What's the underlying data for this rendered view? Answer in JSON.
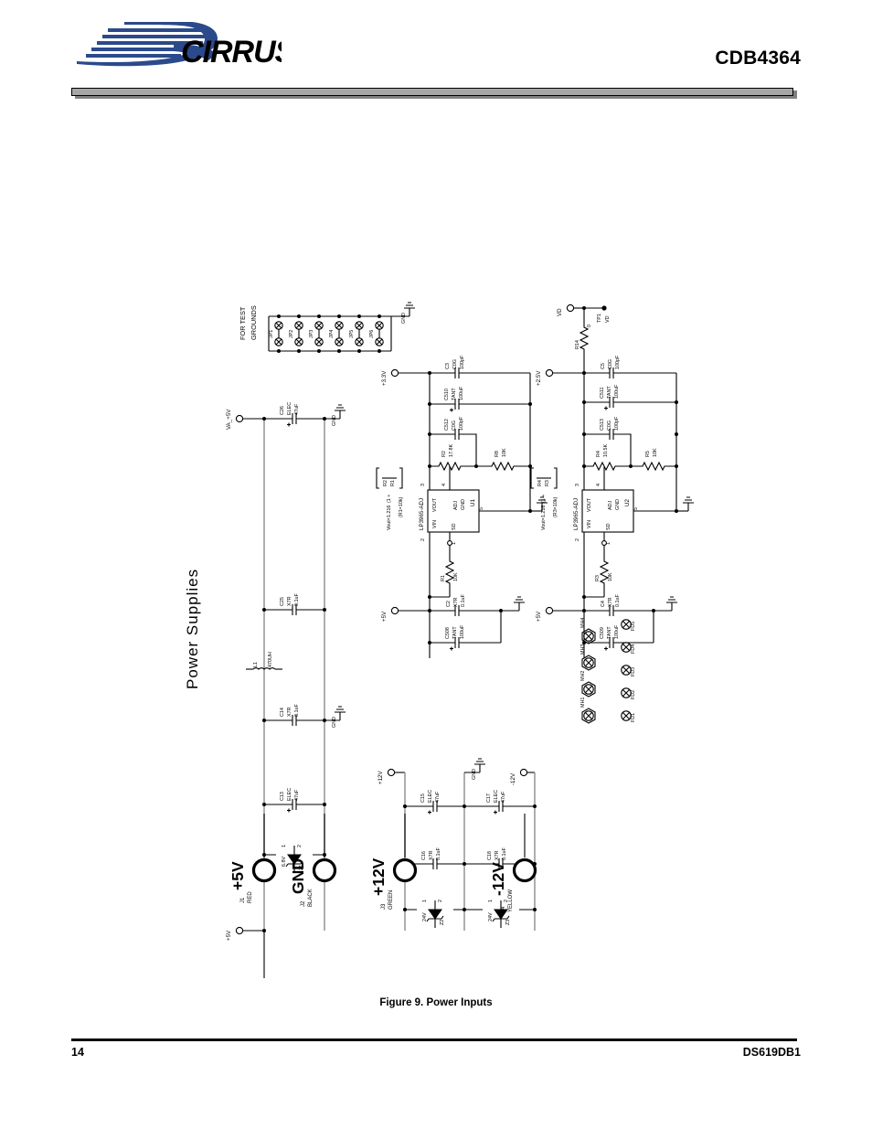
{
  "header": {
    "logo_text": "CIRRUS",
    "logo_name": "cirrus-logic-logo",
    "title": "CDB4364"
  },
  "footer": {
    "figure_caption": "Figure 9.  Power Inputs",
    "page_number": "14",
    "document_number": "DS619DB1"
  },
  "schematic": {
    "block_title": "Power  Supplies",
    "test_ground_header": {
      "label_line1": "FOR TEST",
      "label_line2": "GROUNDS",
      "jumpers": [
        "JP1",
        "JP2",
        "JP3",
        "JP4",
        "JP5",
        "JP6"
      ],
      "gnd": "GND"
    },
    "connectors": [
      {
        "net": "+5V",
        "ref": "J1",
        "color": "RED"
      },
      {
        "net": "GND",
        "ref": "J2",
        "color": "BLACK"
      },
      {
        "net": "+12V",
        "ref": "J3",
        "color": "GREEN"
      },
      {
        "net": "-12V",
        "ref": "J4",
        "color": "YELLOW"
      }
    ],
    "nets": {
      "va5v": "VA_+5V",
      "p5v": "+5V",
      "p12v": "+12V",
      "n12v": "-12V",
      "p33v": "+3.3V",
      "p25v": "+2.5V",
      "vd": "VD",
      "gnd": "GND"
    },
    "inductor": {
      "ref": "L1",
      "value": "470UH"
    },
    "zeners": [
      {
        "ref": "Z1",
        "value": "6.8V",
        "pin1": "1",
        "pin2": "2"
      },
      {
        "ref": "Z2",
        "value": "24V",
        "pin1": "1",
        "pin2": "2"
      },
      {
        "ref": "Z3",
        "value": "24V",
        "pin1": "1",
        "pin2": "2"
      }
    ],
    "capacitors": [
      {
        "ref": "C26",
        "type": "ELEC",
        "value": "47uF",
        "polar": true
      },
      {
        "ref": "C25",
        "type": "X7R",
        "value": "0.1uF",
        "polar": false
      },
      {
        "ref": "C14",
        "type": "X7R",
        "value": "0.1uF",
        "polar": false
      },
      {
        "ref": "C13",
        "type": "ELEC",
        "value": "47uF",
        "polar": true
      },
      {
        "ref": "C15",
        "type": "ELEC",
        "value": "47uF",
        "polar": true
      },
      {
        "ref": "C16",
        "type": "X7R",
        "value": "0.1uF",
        "polar": false
      },
      {
        "ref": "C17",
        "type": "ELEC",
        "value": "47uF",
        "polar": true
      },
      {
        "ref": "C18",
        "type": "X7R",
        "value": "0.1uF",
        "polar": false
      },
      {
        "ref": "C3",
        "type": "C0G",
        "value": "100pF",
        "polar": false
      },
      {
        "ref": "C510",
        "type": "TANT",
        "value": "100uF",
        "polar": true
      },
      {
        "ref": "C512",
        "type": "C0G",
        "value": "100pF",
        "polar": false
      },
      {
        "ref": "C2",
        "type": "X7R",
        "value": "0.1uF",
        "polar": false
      },
      {
        "ref": "C508",
        "type": "TANT",
        "value": "100uF",
        "polar": true
      },
      {
        "ref": "C5",
        "type": "C0G",
        "value": "100pF",
        "polar": false
      },
      {
        "ref": "C511",
        "type": "TANT",
        "value": "100uF",
        "polar": true
      },
      {
        "ref": "C513",
        "type": "C0G",
        "value": "100pF",
        "polar": false
      },
      {
        "ref": "C4",
        "type": "X7R",
        "value": "0.1uF",
        "polar": false
      },
      {
        "ref": "C509",
        "type": "TANT",
        "value": "100uF",
        "polar": true
      }
    ],
    "resistors": [
      {
        "ref": "R1",
        "value": "10K"
      },
      {
        "ref": "R2",
        "value": "17.8K"
      },
      {
        "ref": "R8",
        "value": "10K"
      },
      {
        "ref": "R3",
        "value": "10K"
      },
      {
        "ref": "R4",
        "value": "10.5K"
      },
      {
        "ref": "R5",
        "value": "10K"
      },
      {
        "ref": "R14",
        "value": "0"
      }
    ],
    "regulators": [
      {
        "ref": "U1",
        "part": "LP3965-ADJ",
        "pins": {
          "vin": "VIN",
          "vout": "VOUT",
          "adj": "ADJ",
          "gnd": "GND",
          "sd": "SD"
        },
        "pin_numbers": {
          "vin": "2",
          "vout": "3",
          "adj": "4",
          "gnd": "5",
          "sd": "1"
        }
      },
      {
        "ref": "U2",
        "part": "LP3965-ADJ",
        "pins": {
          "vin": "VIN",
          "vout": "VOUT",
          "adj": "ADJ",
          "gnd": "GND",
          "sd": "SD"
        },
        "pin_numbers": {
          "vin": "2",
          "vout": "3",
          "adj": "4",
          "gnd": "5",
          "sd": "1"
        }
      }
    ],
    "formulas": [
      {
        "for": "U1",
        "expr": "Vout=1.216",
        "factor": "(1 +",
        "num": "R2",
        "den": "R1",
        "note": "(R1=10k)"
      },
      {
        "for": "U2",
        "expr": "Vout=1.216",
        "factor": "(1 +",
        "num": "R4",
        "den": "R3",
        "note": "(R3=10k)"
      }
    ],
    "test_point": {
      "ref": "TP1",
      "net": "VD"
    },
    "mounting_holes": [
      "MH1",
      "MH2",
      "MH3",
      "MH4"
    ],
    "fiducials": [
      "FD1",
      "FD2",
      "FD3",
      "FD4",
      "FD5"
    ]
  }
}
